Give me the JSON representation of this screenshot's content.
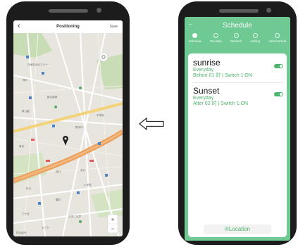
{
  "left_phone": {
    "header": {
      "back_icon": "chevron-left-icon",
      "title": "Positioning",
      "save_label": "Save"
    },
    "map": {
      "labels": [
        "日坂石油ガスバー",
        "神戸",
        "郡山運営",
        "泉公園",
        "野手口",
        "中学校",
        "東京",
        "合計",
        "多分",
        "小学校",
        "外川",
        "春町",
        "三ケ月",
        "中学二中学",
        "中三下"
      ],
      "zoom_in": "+",
      "zoom_out": "−",
      "watermark": "Google"
    }
  },
  "arrow_icon": "left-arrow-icon",
  "right_phone": {
    "header": {
      "back_icon": "arrow-left-icon",
      "title": "Schedule"
    },
    "tabs": [
      {
        "label": "Schedule",
        "icon": "clock-icon"
      },
      {
        "label": "Circulate",
        "icon": "cycle-icon"
      },
      {
        "label": "Random",
        "icon": "random-icon"
      },
      {
        "label": "Inching",
        "icon": "inching-icon"
      },
      {
        "label": "Astronomical",
        "icon": "sun-icon"
      }
    ],
    "items": [
      {
        "name": "sunrise",
        "repeat": "Everyday",
        "detail": "Before 01 时 | Switch 1:ON",
        "enabled": true
      },
      {
        "name": "Sunset",
        "repeat": "Everyday",
        "detail": "After 02 时 | Switch 1:ON",
        "enabled": true
      }
    ],
    "location_button": "®Location"
  },
  "colors": {
    "accent": "#6ec993",
    "accent_dark": "#4cb56c",
    "phone_body": "#1c1c1c"
  }
}
